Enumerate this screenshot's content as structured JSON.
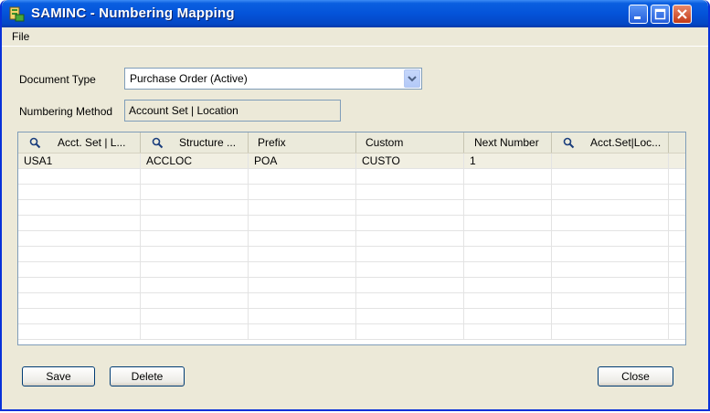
{
  "window": {
    "title": "SAMINC - Numbering Mapping"
  },
  "menu": {
    "file": "File"
  },
  "form": {
    "document_type_label": "Document Type",
    "document_type_value": "Purchase Order (Active)",
    "numbering_method_label": "Numbering Method",
    "numbering_method_value": "Account Set | Location"
  },
  "grid": {
    "columns": [
      "Acct. Set | L...",
      "Structure ...",
      "Prefix",
      "Custom",
      "Next Number",
      "Acct.Set|Loc..."
    ],
    "rows": [
      [
        "USA1",
        "ACCLOC",
        "POA",
        "CUSTO",
        "1",
        ""
      ]
    ]
  },
  "buttons": {
    "save": "Save",
    "delete": "Delete",
    "close": "Close"
  }
}
